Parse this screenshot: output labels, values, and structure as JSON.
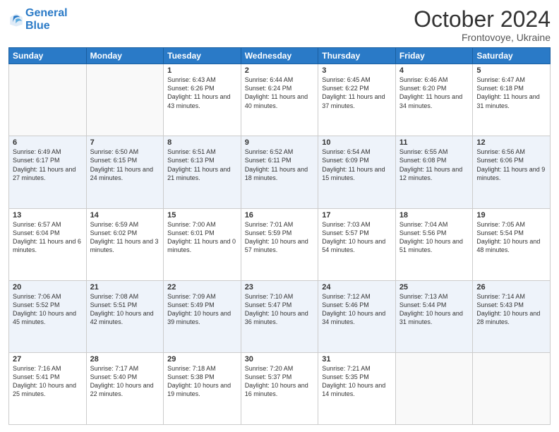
{
  "header": {
    "logo_line1": "General",
    "logo_line2": "Blue",
    "month": "October 2024",
    "location": "Frontovoye, Ukraine"
  },
  "weekdays": [
    "Sunday",
    "Monday",
    "Tuesday",
    "Wednesday",
    "Thursday",
    "Friday",
    "Saturday"
  ],
  "weeks": [
    [
      {
        "day": "",
        "sunrise": "",
        "sunset": "",
        "daylight": ""
      },
      {
        "day": "",
        "sunrise": "",
        "sunset": "",
        "daylight": ""
      },
      {
        "day": "1",
        "sunrise": "Sunrise: 6:43 AM",
        "sunset": "Sunset: 6:26 PM",
        "daylight": "Daylight: 11 hours and 43 minutes."
      },
      {
        "day": "2",
        "sunrise": "Sunrise: 6:44 AM",
        "sunset": "Sunset: 6:24 PM",
        "daylight": "Daylight: 11 hours and 40 minutes."
      },
      {
        "day": "3",
        "sunrise": "Sunrise: 6:45 AM",
        "sunset": "Sunset: 6:22 PM",
        "daylight": "Daylight: 11 hours and 37 minutes."
      },
      {
        "day": "4",
        "sunrise": "Sunrise: 6:46 AM",
        "sunset": "Sunset: 6:20 PM",
        "daylight": "Daylight: 11 hours and 34 minutes."
      },
      {
        "day": "5",
        "sunrise": "Sunrise: 6:47 AM",
        "sunset": "Sunset: 6:18 PM",
        "daylight": "Daylight: 11 hours and 31 minutes."
      }
    ],
    [
      {
        "day": "6",
        "sunrise": "Sunrise: 6:49 AM",
        "sunset": "Sunset: 6:17 PM",
        "daylight": "Daylight: 11 hours and 27 minutes."
      },
      {
        "day": "7",
        "sunrise": "Sunrise: 6:50 AM",
        "sunset": "Sunset: 6:15 PM",
        "daylight": "Daylight: 11 hours and 24 minutes."
      },
      {
        "day": "8",
        "sunrise": "Sunrise: 6:51 AM",
        "sunset": "Sunset: 6:13 PM",
        "daylight": "Daylight: 11 hours and 21 minutes."
      },
      {
        "day": "9",
        "sunrise": "Sunrise: 6:52 AM",
        "sunset": "Sunset: 6:11 PM",
        "daylight": "Daylight: 11 hours and 18 minutes."
      },
      {
        "day": "10",
        "sunrise": "Sunrise: 6:54 AM",
        "sunset": "Sunset: 6:09 PM",
        "daylight": "Daylight: 11 hours and 15 minutes."
      },
      {
        "day": "11",
        "sunrise": "Sunrise: 6:55 AM",
        "sunset": "Sunset: 6:08 PM",
        "daylight": "Daylight: 11 hours and 12 minutes."
      },
      {
        "day": "12",
        "sunrise": "Sunrise: 6:56 AM",
        "sunset": "Sunset: 6:06 PM",
        "daylight": "Daylight: 11 hours and 9 minutes."
      }
    ],
    [
      {
        "day": "13",
        "sunrise": "Sunrise: 6:57 AM",
        "sunset": "Sunset: 6:04 PM",
        "daylight": "Daylight: 11 hours and 6 minutes."
      },
      {
        "day": "14",
        "sunrise": "Sunrise: 6:59 AM",
        "sunset": "Sunset: 6:02 PM",
        "daylight": "Daylight: 11 hours and 3 minutes."
      },
      {
        "day": "15",
        "sunrise": "Sunrise: 7:00 AM",
        "sunset": "Sunset: 6:01 PM",
        "daylight": "Daylight: 11 hours and 0 minutes."
      },
      {
        "day": "16",
        "sunrise": "Sunrise: 7:01 AM",
        "sunset": "Sunset: 5:59 PM",
        "daylight": "Daylight: 10 hours and 57 minutes."
      },
      {
        "day": "17",
        "sunrise": "Sunrise: 7:03 AM",
        "sunset": "Sunset: 5:57 PM",
        "daylight": "Daylight: 10 hours and 54 minutes."
      },
      {
        "day": "18",
        "sunrise": "Sunrise: 7:04 AM",
        "sunset": "Sunset: 5:56 PM",
        "daylight": "Daylight: 10 hours and 51 minutes."
      },
      {
        "day": "19",
        "sunrise": "Sunrise: 7:05 AM",
        "sunset": "Sunset: 5:54 PM",
        "daylight": "Daylight: 10 hours and 48 minutes."
      }
    ],
    [
      {
        "day": "20",
        "sunrise": "Sunrise: 7:06 AM",
        "sunset": "Sunset: 5:52 PM",
        "daylight": "Daylight: 10 hours and 45 minutes."
      },
      {
        "day": "21",
        "sunrise": "Sunrise: 7:08 AM",
        "sunset": "Sunset: 5:51 PM",
        "daylight": "Daylight: 10 hours and 42 minutes."
      },
      {
        "day": "22",
        "sunrise": "Sunrise: 7:09 AM",
        "sunset": "Sunset: 5:49 PM",
        "daylight": "Daylight: 10 hours and 39 minutes."
      },
      {
        "day": "23",
        "sunrise": "Sunrise: 7:10 AM",
        "sunset": "Sunset: 5:47 PM",
        "daylight": "Daylight: 10 hours and 36 minutes."
      },
      {
        "day": "24",
        "sunrise": "Sunrise: 7:12 AM",
        "sunset": "Sunset: 5:46 PM",
        "daylight": "Daylight: 10 hours and 34 minutes."
      },
      {
        "day": "25",
        "sunrise": "Sunrise: 7:13 AM",
        "sunset": "Sunset: 5:44 PM",
        "daylight": "Daylight: 10 hours and 31 minutes."
      },
      {
        "day": "26",
        "sunrise": "Sunrise: 7:14 AM",
        "sunset": "Sunset: 5:43 PM",
        "daylight": "Daylight: 10 hours and 28 minutes."
      }
    ],
    [
      {
        "day": "27",
        "sunrise": "Sunrise: 7:16 AM",
        "sunset": "Sunset: 5:41 PM",
        "daylight": "Daylight: 10 hours and 25 minutes."
      },
      {
        "day": "28",
        "sunrise": "Sunrise: 7:17 AM",
        "sunset": "Sunset: 5:40 PM",
        "daylight": "Daylight: 10 hours and 22 minutes."
      },
      {
        "day": "29",
        "sunrise": "Sunrise: 7:18 AM",
        "sunset": "Sunset: 5:38 PM",
        "daylight": "Daylight: 10 hours and 19 minutes."
      },
      {
        "day": "30",
        "sunrise": "Sunrise: 7:20 AM",
        "sunset": "Sunset: 5:37 PM",
        "daylight": "Daylight: 10 hours and 16 minutes."
      },
      {
        "day": "31",
        "sunrise": "Sunrise: 7:21 AM",
        "sunset": "Sunset: 5:35 PM",
        "daylight": "Daylight: 10 hours and 14 minutes."
      },
      {
        "day": "",
        "sunrise": "",
        "sunset": "",
        "daylight": ""
      },
      {
        "day": "",
        "sunrise": "",
        "sunset": "",
        "daylight": ""
      }
    ]
  ]
}
